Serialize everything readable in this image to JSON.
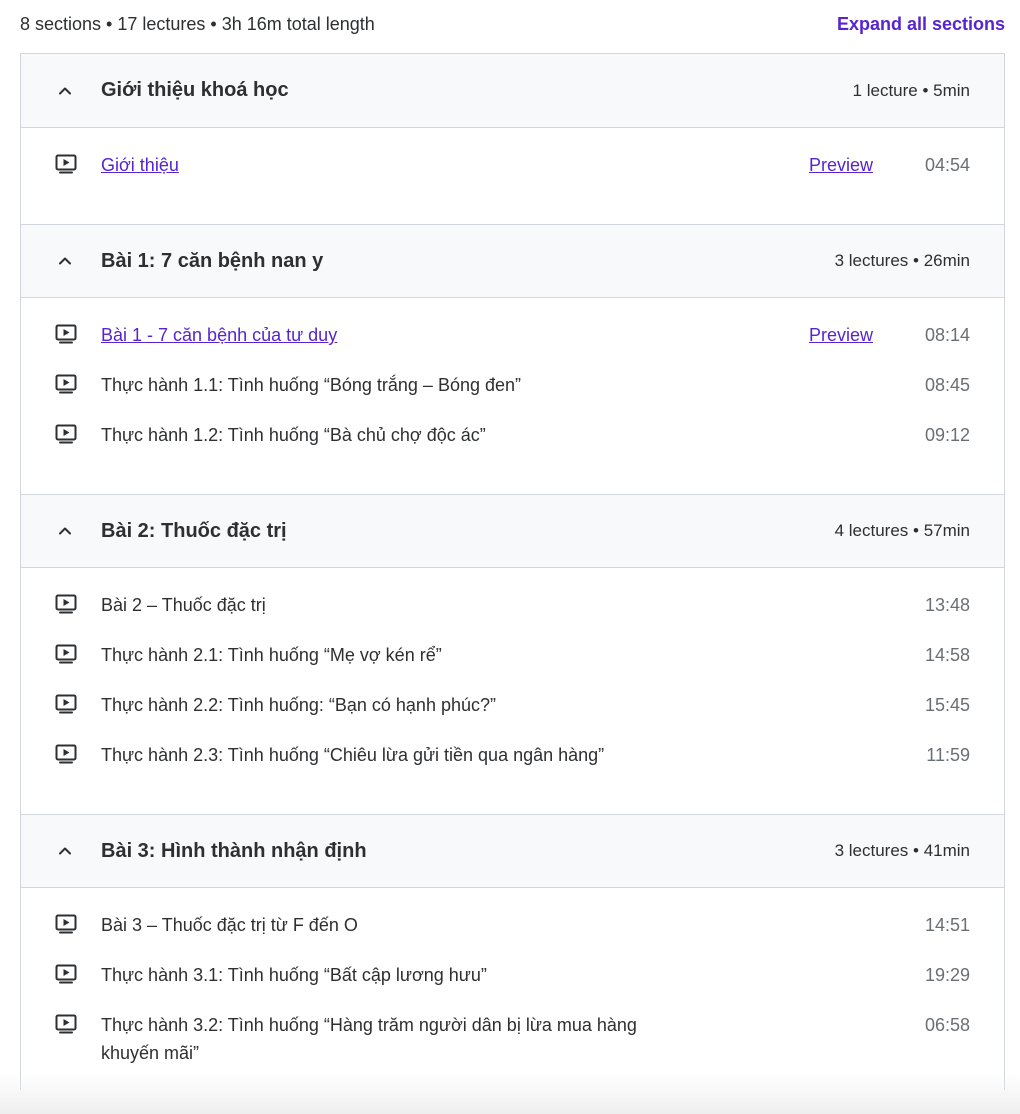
{
  "summary": {
    "text": "8 sections • 17 lectures • 3h 16m total length",
    "expand_label": "Expand all sections"
  },
  "colors": {
    "accent": "#5624d0",
    "text": "#2d2f31",
    "muted": "#6a6f73",
    "header_bg": "#f7f9fa",
    "border": "#d1d7dc"
  },
  "icons": {
    "chevron": "chevron-up-icon",
    "lecture": "video-play-icon"
  },
  "sections": [
    {
      "title": "Giới thiệu khoá học",
      "meta": "1 lecture • 5min",
      "lectures": [
        {
          "title": "Giới thiệu",
          "preview": "Preview",
          "duration": "04:54"
        }
      ]
    },
    {
      "title": "Bài 1: 7 căn bệnh nan y",
      "meta": "3 lectures • 26min",
      "lectures": [
        {
          "title": "Bài 1 - 7 căn bệnh của tư duy",
          "preview": "Preview",
          "duration": "08:14"
        },
        {
          "title": "Thực hành 1.1: Tình huống “Bóng trắng – Bóng đen”",
          "duration": "08:45"
        },
        {
          "title": "Thực hành 1.2: Tình huống “Bà chủ chợ độc ác”",
          "duration": "09:12"
        }
      ]
    },
    {
      "title": "Bài 2: Thuốc đặc trị",
      "meta": "4 lectures • 57min",
      "lectures": [
        {
          "title": "Bài 2 – Thuốc đặc trị",
          "duration": "13:48"
        },
        {
          "title": "Thực hành 2.1: Tình huống “Mẹ vợ kén rể”",
          "duration": "14:58"
        },
        {
          "title": "Thực hành 2.2: Tình huống: “Bạn có hạnh phúc?”",
          "duration": "15:45"
        },
        {
          "title": "Thực hành 2.3: Tình huống “Chiêu lừa gửi tiền qua ngân hàng”",
          "duration": "11:59"
        }
      ]
    },
    {
      "title": "Bài 3: Hình thành nhận định",
      "meta": "3 lectures • 41min",
      "lectures": [
        {
          "title": "Bài 3 – Thuốc đặc trị từ F đến O",
          "duration": "14:51"
        },
        {
          "title": "Thực hành 3.1: Tình huống “Bất cập lương hưu”",
          "duration": "19:29"
        },
        {
          "title": "Thực hành 3.2: Tình huống “Hàng trăm người dân bị lừa mua hàng khuyến mãi”",
          "duration": "06:58"
        }
      ]
    }
  ]
}
